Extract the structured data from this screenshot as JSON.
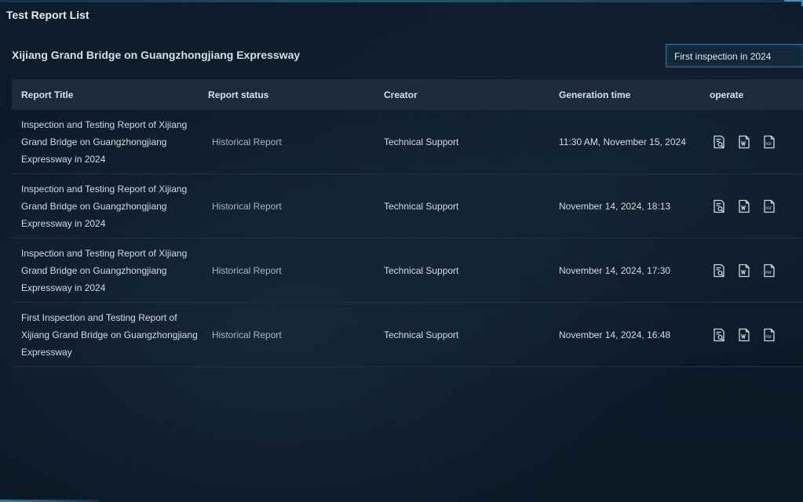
{
  "header": {
    "title": "Test Report List"
  },
  "project": {
    "title": "Xijiang Grand Bridge on Guangzhongjiang Expressway"
  },
  "filter": {
    "selected": "First inspection in 2024"
  },
  "table": {
    "columns": [
      "Report Title",
      "Report status",
      "Creator",
      "Generation time",
      "operate"
    ],
    "rows": [
      {
        "title": "Inspection and Testing Report of Xijiang Grand Bridge on Guangzhongjiang Expressway in 2024",
        "status": "Historical Report",
        "creator": "Technical Support",
        "time": "11:30 AM, November 15, 2024"
      },
      {
        "title": "Inspection and Testing Report of Xijiang Grand Bridge on Guangzhongjiang Expressway in 2024",
        "status": "Historical Report",
        "creator": "Technical Support",
        "time": "November 14, 2024, 18:13"
      },
      {
        "title": "Inspection and Testing Report of Xijiang Grand Bridge on Guangzhongjiang Expressway in 2024",
        "status": "Historical Report",
        "creator": "Technical Support",
        "time": "November 14, 2024, 17:30"
      },
      {
        "title": "First Inspection and Testing Report of Xijiang Grand Bridge on Guangzhongjiang Expressway",
        "status": "Historical Report",
        "creator": "Technical Support",
        "time": "November 14, 2024, 16:48"
      }
    ],
    "operate_icons": [
      "preview-report-icon",
      "word-document-icon",
      "pdf-document-icon"
    ]
  },
  "colors": {
    "background": "#0c1a29",
    "header_row": "#1b2b3c",
    "accent": "#3e8fb8",
    "text": "#d3dbe3",
    "status_text": "#a9b4bf"
  }
}
